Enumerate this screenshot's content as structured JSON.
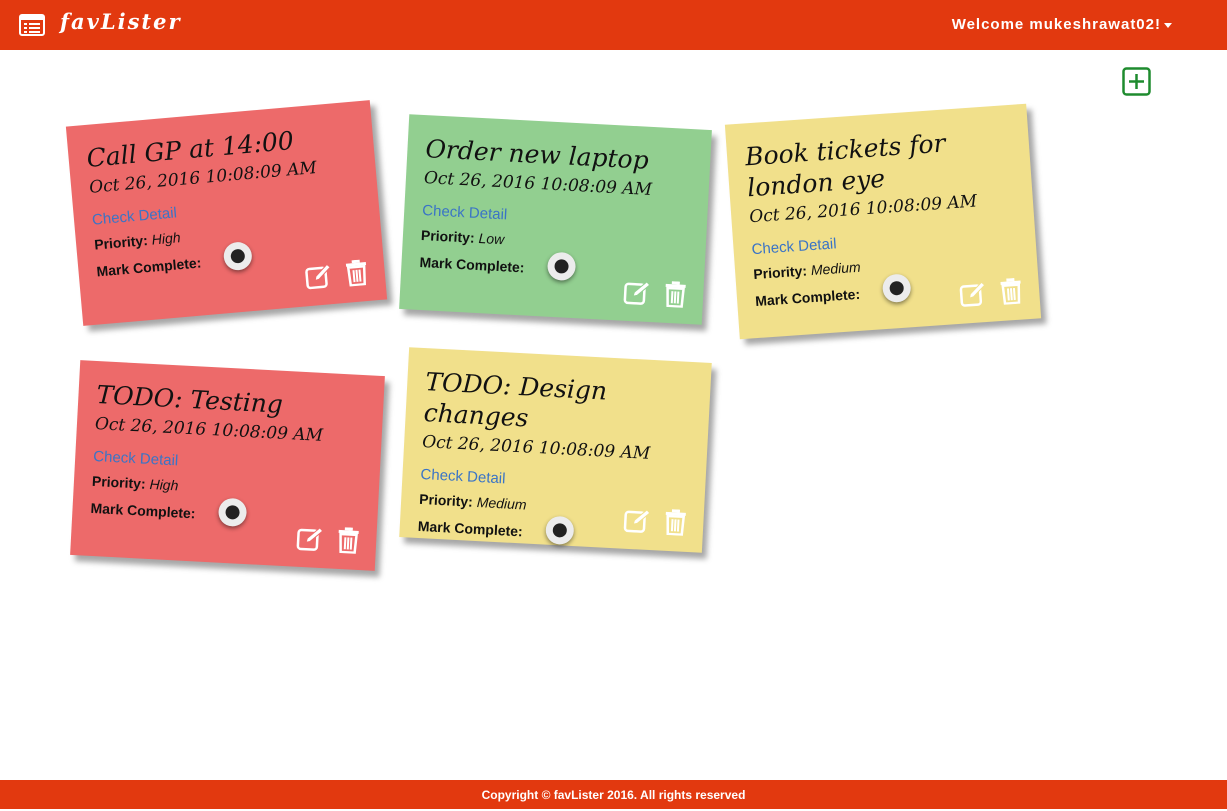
{
  "header": {
    "brand": "favLister",
    "welcome": "Welcome mukeshrawat02!",
    "menu_icon": "list-icon",
    "user_dropdown_icon": "caret-down-icon"
  },
  "toolbar": {
    "add_icon": "plus-square-icon",
    "add_color": "#1e8b2e"
  },
  "colors": {
    "header": "#e2390f",
    "note_high": "#ed6a6a",
    "note_low": "#92cf90",
    "note_medium": "#f1e08b",
    "link": "#3a74c6"
  },
  "notes": [
    {
      "title": "Call GP at 14:00",
      "date": "Oct 26, 2016 10:08:09 AM",
      "detail_link": "Check Detail",
      "priority_label": "Priority:",
      "priority": "High",
      "complete_label": "Mark Complete:",
      "edit_icon": "edit-icon",
      "delete_icon": "trash-icon"
    },
    {
      "title": "Order new laptop",
      "date": "Oct 26, 2016 10:08:09 AM",
      "detail_link": "Check Detail",
      "priority_label": "Priority:",
      "priority": "Low",
      "complete_label": "Mark Complete:",
      "edit_icon": "edit-icon",
      "delete_icon": "trash-icon"
    },
    {
      "title": "Book tickets for london eye",
      "date": "Oct 26, 2016 10:08:09 AM",
      "detail_link": "Check Detail",
      "priority_label": "Priority:",
      "priority": "Medium",
      "complete_label": "Mark Complete:",
      "edit_icon": "edit-icon",
      "delete_icon": "trash-icon"
    },
    {
      "title": "TODO: Testing",
      "date": "Oct 26, 2016 10:08:09 AM",
      "detail_link": "Check Detail",
      "priority_label": "Priority:",
      "priority": "High",
      "complete_label": "Mark Complete:",
      "edit_icon": "edit-icon",
      "delete_icon": "trash-icon"
    },
    {
      "title": "TODO: Design changes",
      "date": "Oct 26, 2016 10:08:09 AM",
      "detail_link": "Check Detail",
      "priority_label": "Priority:",
      "priority": "Medium",
      "complete_label": "Mark Complete:",
      "edit_icon": "edit-icon",
      "delete_icon": "trash-icon"
    }
  ],
  "footer": {
    "copyright": "Copyright © favLister 2016. All rights reserved"
  }
}
